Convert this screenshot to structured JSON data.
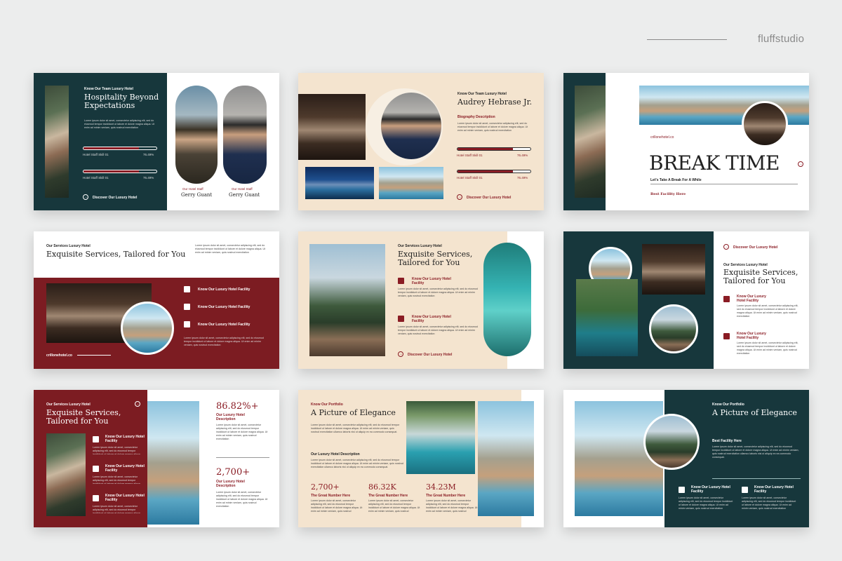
{
  "brand": {
    "name": "fluffstudio"
  },
  "colors": {
    "teal": "#17373c",
    "maroon": "#7c1c22",
    "cream": "#f4e4cf",
    "accent_red": "#8a1c24"
  },
  "lorem": "Lorem ipsum dolor sit amet, consectetur adipiscing elit, sed do eiusmod tempor incididunt ut labore et dolore magna aliqua. Ut enim ad minim veniam, quis nostrud exercitation ullamco laboris nisi ut aliquip ex ea commodo consequat.",
  "lorem_short": "Lorem ipsum dolor sit amet, consectetur adipiscing elit, sed do eiusmod tempor incididunt ut labore et dolore magna aliqua. Ut enim ad minim veniam, quis nostrud exercitation",
  "s1": {
    "tag": "Know Our Team Luxury Hotel",
    "title": "Hospitality Beyond Expectations",
    "skill1": {
      "label": "Hotel Staff Skill 01",
      "value": "76.49%",
      "progress": 0.76
    },
    "skill2": {
      "label": "Hotel Staff Skill 01",
      "value": "76.49%",
      "progress": 0.76
    },
    "cta": "Discover Our Luxury Hotel",
    "staff1": {
      "role": "Our Hotel Staff",
      "name": "Gerry Guant"
    },
    "staff2": {
      "role": "Our Hotel Staff",
      "name": "Gerry Guant"
    }
  },
  "s2": {
    "tag": "Know Our Team Luxury Hotel",
    "title": "Audrey Hebrase Jr.",
    "subtitle": "Biography Description",
    "skill1": {
      "label": "Hotel Staff Skill 01",
      "value": "76.49%",
      "progress": 0.76
    },
    "skill2": {
      "label": "Hotel Staff Skill 01",
      "value": "76.49%",
      "progress": 0.76
    },
    "cta": "Discover Our Luxury Hotel"
  },
  "s3": {
    "site": "crillonehotel.co",
    "title": "BREAK TIME",
    "subtitle": "Let's Take A Break For A While",
    "footer": "Best Facility Here"
  },
  "s4": {
    "tag": "Our Services Luxury Hotel",
    "title": "Exquisite Services, Tailored for You",
    "items": [
      "Know Our Luxury Hotel Facility",
      "Know Our Luxury Hotel Facility",
      "Know Our Luxury Hotel Facility"
    ],
    "site": "crillonehotel.co"
  },
  "s5": {
    "tag": "Our Services Luxury Hotel",
    "title": "Exquisite Services, Tailored for You",
    "item1": "Know Our Luxury Hotel Facility",
    "item2": "Know Our Luxury Hotel Facility",
    "cta": "Discover Our Luxury Hotel"
  },
  "s6": {
    "cta": "Discover Our Luxury Hotel",
    "tag": "Our Services Luxury Hotel",
    "title": "Exquisite Services, Tailored for You",
    "item1": "Know Our Luxury Hotel Facility",
    "item2": "Know Our Luxury Hotel Facility"
  },
  "s7": {
    "tag": "Our Services Luxury Hotel",
    "title": "Exquisite Services, Tailored for You",
    "items": [
      "Know Our Luxury Hotel Facility",
      "Know Our Luxury Hotel Facility",
      "Know Our Luxury Hotel Facility"
    ],
    "stat1": {
      "value": "86.82%+",
      "label": "Our Luxury Hotel Description"
    },
    "stat2": {
      "value": "2,700+",
      "label": "Our Luxury Hotel Description"
    }
  },
  "s8": {
    "tag": "Know Our Portfolio",
    "title": "A Picture of Elegance",
    "subtitle": "Our Luxury Hotel Description",
    "stats": [
      {
        "value": "2,700+",
        "label": "The Great Number Here"
      },
      {
        "value": "86.32K",
        "label": "The Great Number Here"
      },
      {
        "value": "34.23M",
        "label": "The Great Number Here"
      }
    ]
  },
  "s9": {
    "tag": "Know Our Portfolio",
    "title": "A Picture of Elegance",
    "subtitle": "Best Facility Here",
    "item1": "Know Our Luxury Hotel Facility",
    "item2": "Know Our Luxury Hotel Facility"
  }
}
